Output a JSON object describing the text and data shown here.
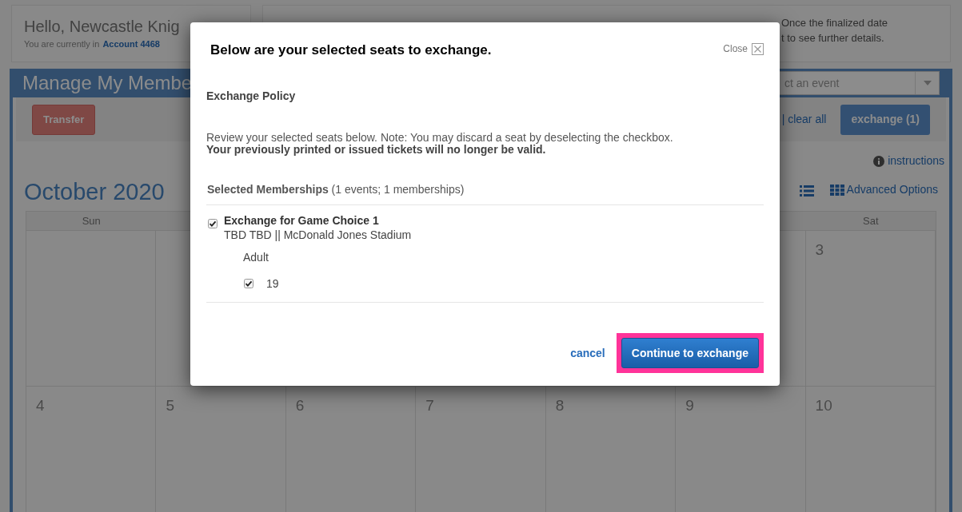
{
  "greeting": {
    "title": "Hello, Newcastle Knig",
    "account_prefix": "You are currently in",
    "account": "Account 4468"
  },
  "notice": {
    "lines": [
      "Once the finalized date",
      "t to see further details."
    ]
  },
  "panel": {
    "title": "Manage My Membe",
    "event_select": {
      "placeholder": "ct an event"
    },
    "transfer_button": "Transfer",
    "clear_link": "| clear all",
    "exchange_button": "exchange (1)",
    "instructions_link": "instructions",
    "advanced_options": "Advanced Options"
  },
  "calendar": {
    "month": "October 2020",
    "weekday_headers": [
      "Sun",
      "Sat"
    ],
    "weeks": [
      [
        "3"
      ],
      [
        "4",
        "5",
        "6",
        "7",
        "8",
        "9",
        "10"
      ]
    ]
  },
  "modal": {
    "title": "Below are your selected seats to exchange.",
    "close_label": "Close",
    "section_title": "Exchange Policy",
    "note": "Review your selected seats below. Note: You may discard a seat by deselecting the checkbox.",
    "warning": "Your previously printed or issued tickets will no longer be valid.",
    "memberships_heading": "**Selected Memberships** (1 events; 1 memberships)",
    "events": [
      {
        "checked": true,
        "title": "Exchange for Game Choice 1",
        "subtitle": "TBD TBD || McDonald Jones Stadium",
        "ticket_type": "Adult",
        "seats": [
          {
            "label": "19",
            "checked": true
          }
        ]
      }
    ],
    "cancel_link": "cancel",
    "continue_button": "Continue to exchange",
    "continue_highlighted": true
  }
}
